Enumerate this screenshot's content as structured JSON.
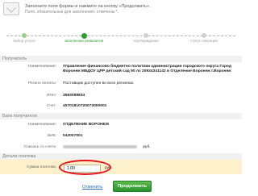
{
  "header": {
    "title": "Заполните поля формы и нажмите на кнопку «Продолжить».",
    "subtitle": "Поля, обязательные для заполнения, отмечены *."
  },
  "steps": [
    {
      "label": "выбор услуги",
      "state": "done"
    },
    {
      "label": "заполнение реквизитов",
      "state": "active"
    },
    {
      "label": "подтверждение",
      "state": "pending"
    },
    {
      "label": "статус операции",
      "state": "pending"
    }
  ],
  "recipient": {
    "section_title": "Получатель",
    "name_label": "Наименование:",
    "name_value": "Управление финансово бюджетно политики администрации городского округа Город Воронеж МБДОУ ЦРР детский сад 90 лс 20924341142 в Отделение Воронеж г.Воронеж",
    "region_label": "Регион оплаты:",
    "region_value": "Поставщик доступен во всех регионах.",
    "inn_label": "ИНН:",
    "inn_value": "3663089834",
    "account_label": "Счет:",
    "account_value": "40701810720073000001"
  },
  "bank": {
    "section_title": "Банк получателя",
    "name_label": "Наименование:",
    "name_value": "ОТДЕЛЕНИЕ ВОРОНЕЖ",
    "bik_label": "БИК:",
    "bik_value": "042007001",
    "debit_label": "Списать со счета:",
    "debit_currency": "руб."
  },
  "payment": {
    "section_title": "Детали платежа",
    "sum_label": "Сумма платежа:",
    "sum_value": "1.00",
    "sum_currency": "руб."
  },
  "actions": {
    "cancel_label": "Отменить",
    "continue_label": "Продолжить"
  },
  "colors": {
    "accent_green": "#2d9f2e",
    "highlight_red": "#e3141e",
    "sum_row_bg": "#fdf1cc"
  }
}
